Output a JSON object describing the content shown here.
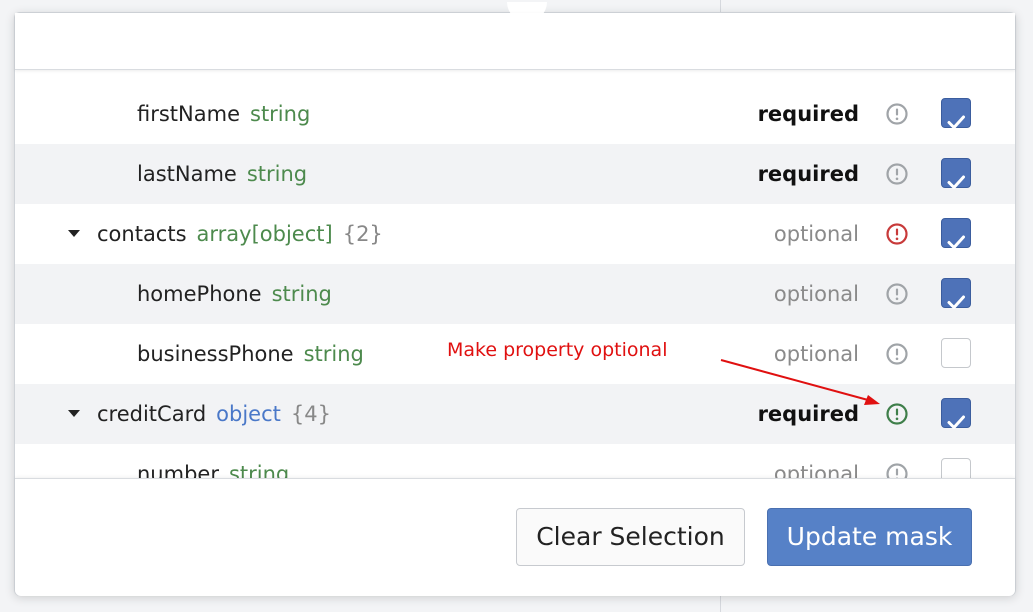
{
  "rows": [
    {
      "name": "firstName",
      "type": "string",
      "count": "",
      "status": "required",
      "checked": true
    },
    {
      "name": "lastName",
      "type": "string",
      "count": "",
      "status": "required",
      "checked": true
    },
    {
      "name": "contacts",
      "type": "array[object]",
      "count": "{2}",
      "status": "optional",
      "checked": true
    },
    {
      "name": "homePhone",
      "type": "string",
      "count": "",
      "status": "optional",
      "checked": true
    },
    {
      "name": "businessPhone",
      "type": "string",
      "count": "",
      "status": "optional",
      "checked": false
    },
    {
      "name": "creditCard",
      "type": "object",
      "count": "{4}",
      "status": "required",
      "checked": true
    },
    {
      "name": "number",
      "type": "string",
      "count": "",
      "status": "optional",
      "checked": false
    }
  ],
  "annotation": {
    "text": "Make property optional",
    "color": "#e01010"
  },
  "footer": {
    "clear_label": "Clear Selection",
    "update_label": "Update mask"
  },
  "colors": {
    "accent": "#5681c7",
    "checkbox_on": "#4e72b8",
    "type_string": "#4d8a4d",
    "type_object": "#4a78c8",
    "icon_grey": "#a0a4a8",
    "icon_red": "#c83a3a",
    "icon_green": "#3f7f4a"
  }
}
